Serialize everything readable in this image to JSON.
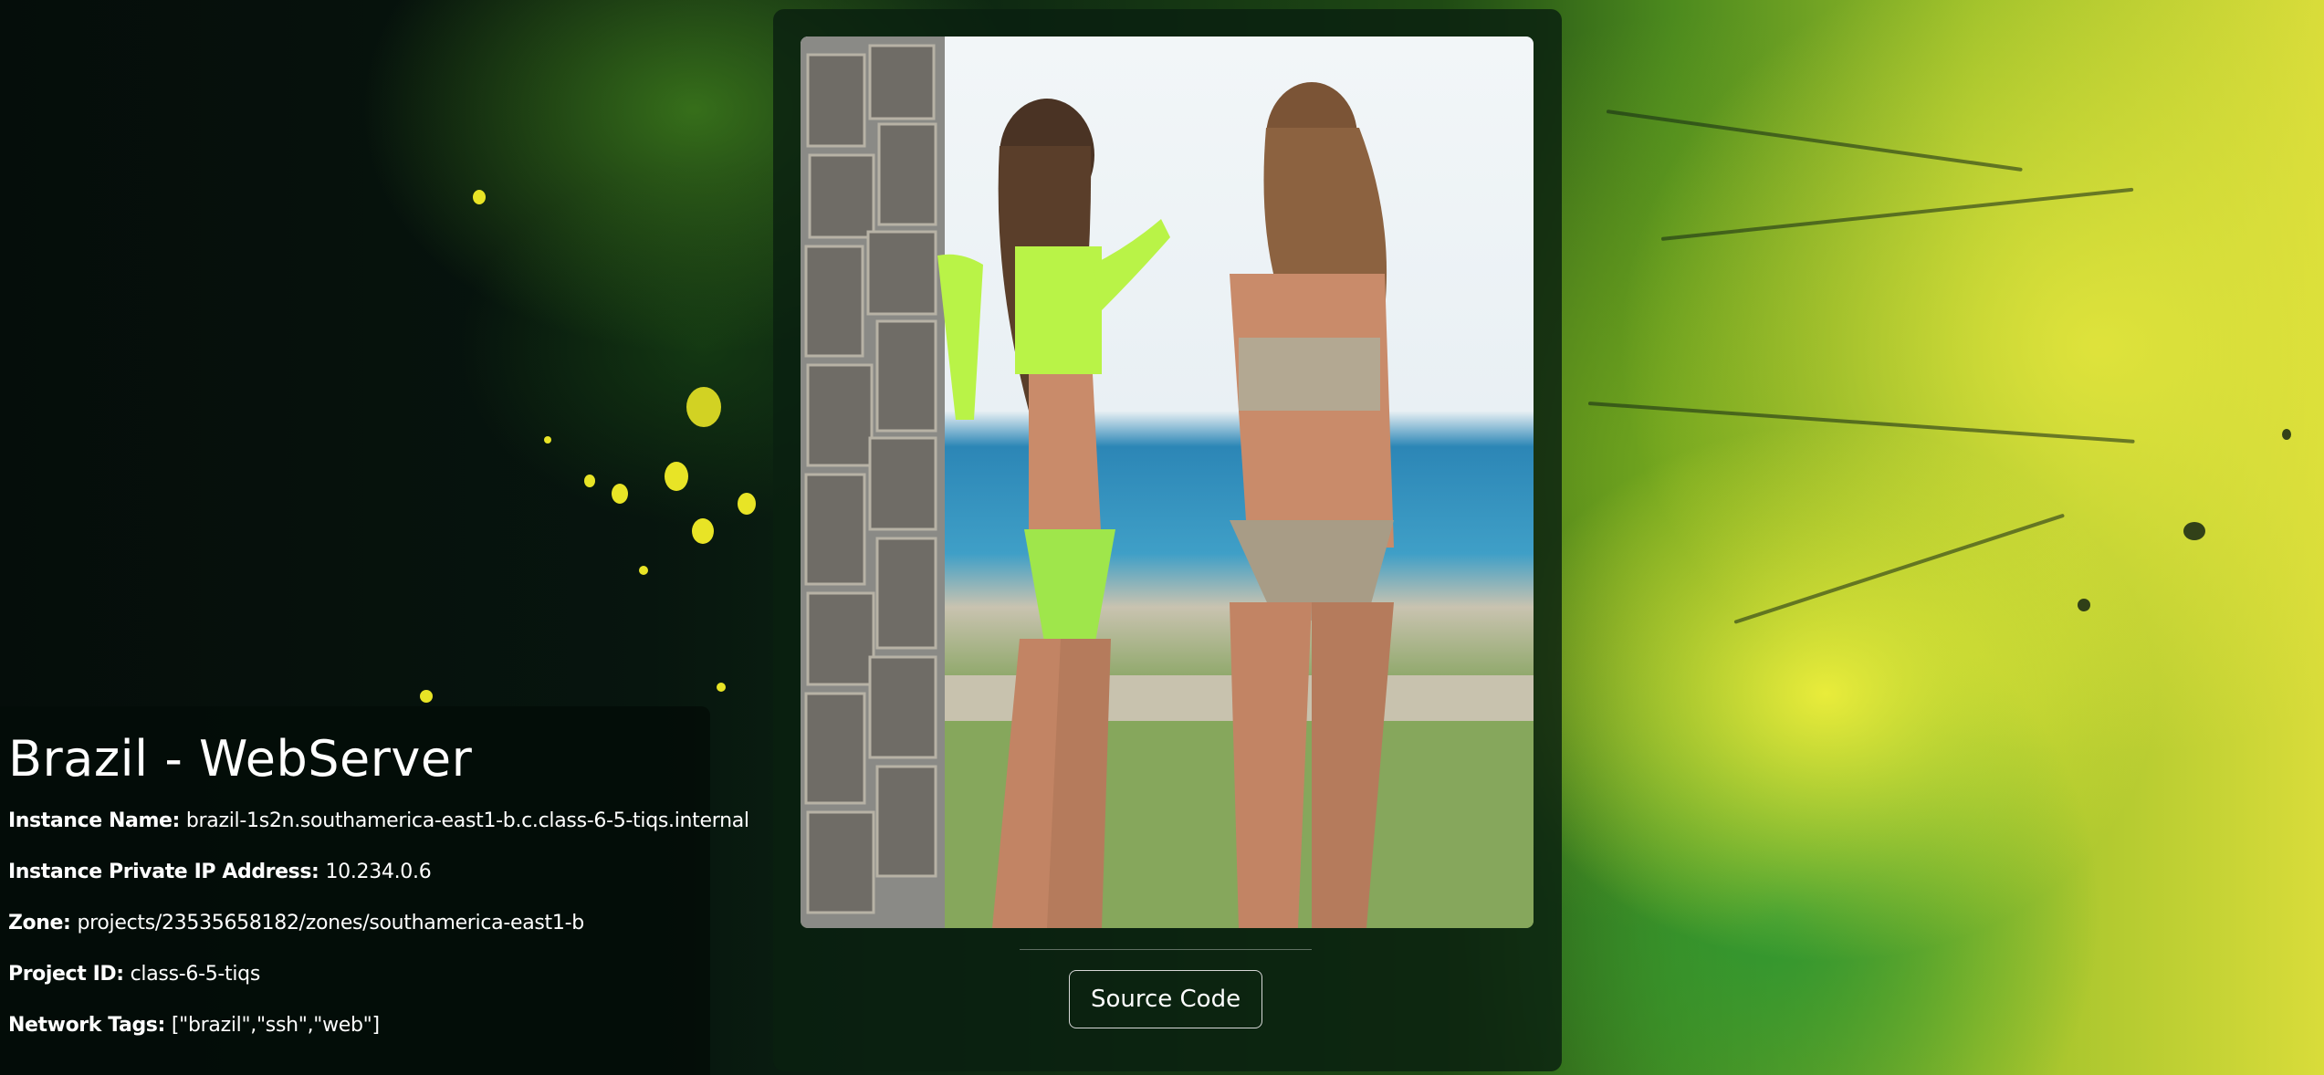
{
  "page": {
    "title": "Brazil - WebServer",
    "source_button_label": "Source Code"
  },
  "info": {
    "instance_name": {
      "label": "Instance Name:",
      "value": "brazil-1s2n.southamerica-east1-b.c.class-6-5-tiqs.internal"
    },
    "private_ip": {
      "label": "Instance Private IP Address:",
      "value": "10.234.0.6"
    },
    "zone": {
      "label": "Zone:",
      "value": "projects/23535658182/zones/southamerica-east1-b"
    },
    "project_id": {
      "label": "Project ID:",
      "value": "class-6-5-tiqs"
    },
    "network_tags": {
      "label": "Network Tags:",
      "value": "[\"brazil\",\"ssh\",\"web\"]"
    }
  },
  "colors": {
    "flag_yellow": "#e8e426",
    "flag_green": "#2f9a3c",
    "panel_dark": "#030c08"
  }
}
